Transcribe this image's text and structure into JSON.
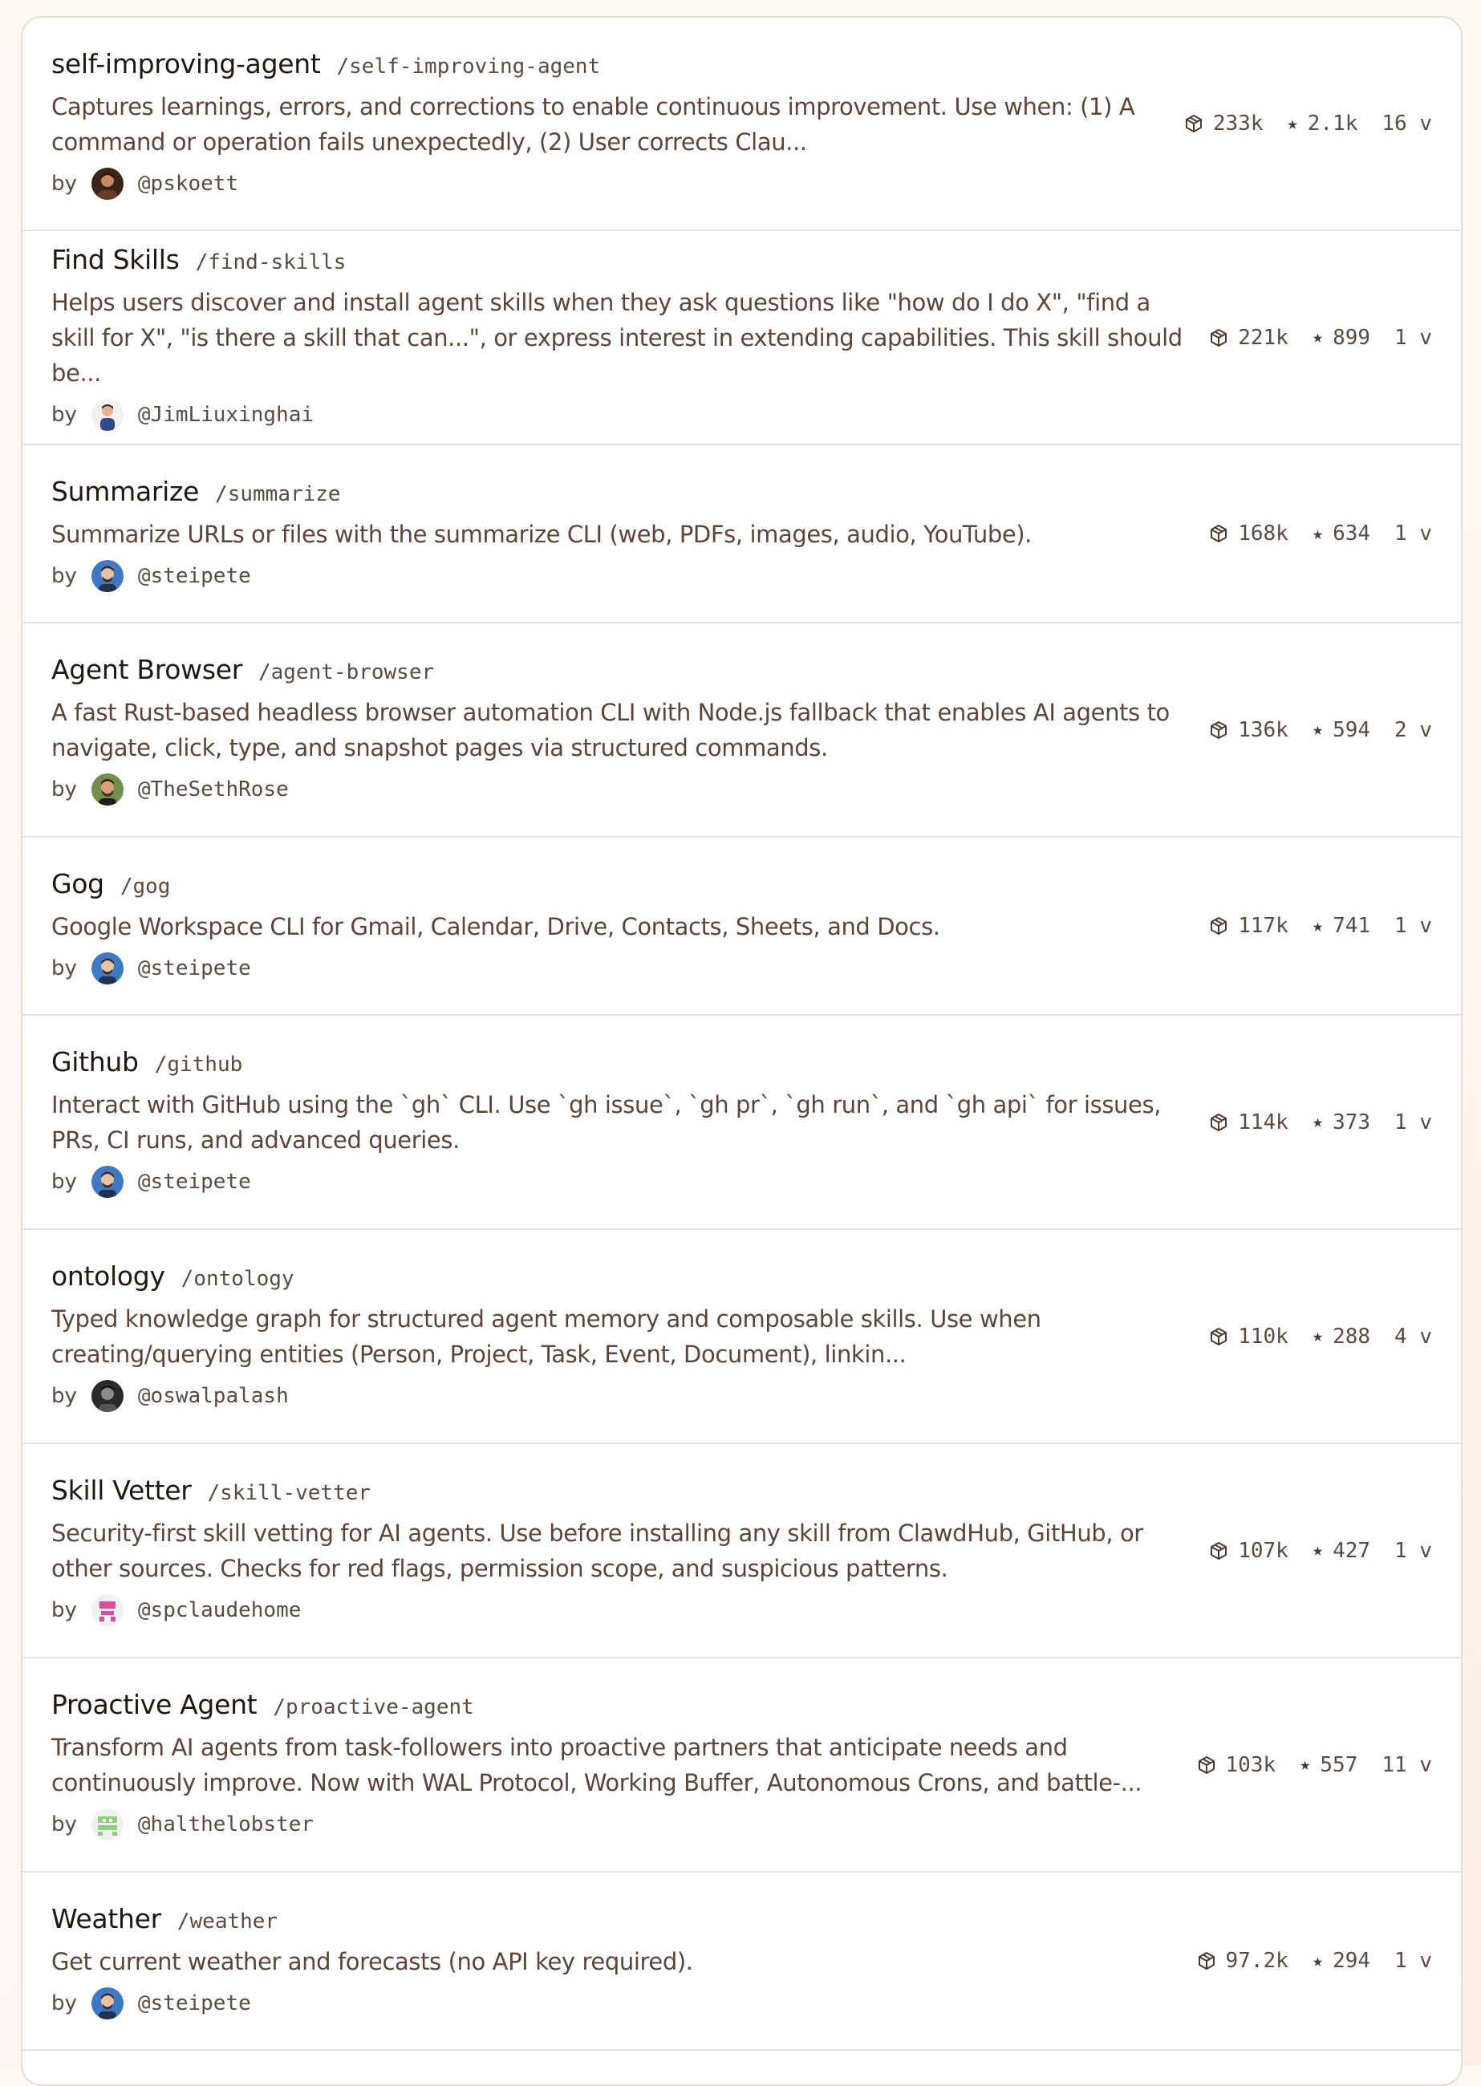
{
  "skills": [
    {
      "name": "self-improving-agent",
      "slug": "/self-improving-agent",
      "description": "Captures learnings, errors, and corrections to enable continuous improvement. Use when: (1) A command or operation fails unexpectedly, (2) User corrects Clau...",
      "by_label": "by",
      "author": "@pskoett",
      "avatar_icon": "user-avatar-icon",
      "downloads": "233k",
      "stars": "2.1k",
      "versions": "16 v"
    },
    {
      "name": "Find Skills",
      "slug": "/find-skills",
      "description": "Helps users discover and install agent skills when they ask questions like \"how do I do X\", \"find a skill for X\", \"is there a skill that can...\", or express interest in extending capabilities. This skill should be...",
      "by_label": "by",
      "author": "@JimLiuxinghai",
      "avatar_icon": "user-avatar-icon",
      "downloads": "221k",
      "stars": "899",
      "versions": "1 v"
    },
    {
      "name": "Summarize",
      "slug": "/summarize",
      "description": "Summarize URLs or files with the summarize CLI (web, PDFs, images, audio, YouTube).",
      "by_label": "by",
      "author": "@steipete",
      "avatar_icon": "user-avatar-icon",
      "downloads": "168k",
      "stars": "634",
      "versions": "1 v"
    },
    {
      "name": "Agent Browser",
      "slug": "/agent-browser",
      "description": "A fast Rust-based headless browser automation CLI with Node.js fallback that enables AI agents to navigate, click, type, and snapshot pages via structured commands.",
      "by_label": "by",
      "author": "@TheSethRose",
      "avatar_icon": "user-avatar-icon",
      "downloads": "136k",
      "stars": "594",
      "versions": "2 v"
    },
    {
      "name": "Gog",
      "slug": "/gog",
      "description": "Google Workspace CLI for Gmail, Calendar, Drive, Contacts, Sheets, and Docs.",
      "by_label": "by",
      "author": "@steipete",
      "avatar_icon": "user-avatar-icon",
      "downloads": "117k",
      "stars": "741",
      "versions": "1 v"
    },
    {
      "name": "Github",
      "slug": "/github",
      "description": "Interact with GitHub using the `gh` CLI. Use `gh issue`, `gh pr`, `gh run`, and `gh api` for issues, PRs, CI runs, and advanced queries.",
      "by_label": "by",
      "author": "@steipete",
      "avatar_icon": "user-avatar-icon",
      "downloads": "114k",
      "stars": "373",
      "versions": "1 v"
    },
    {
      "name": "ontology",
      "slug": "/ontology",
      "description": "Typed knowledge graph for structured agent memory and composable skills. Use when creating/querying entities (Person, Project, Task, Event, Document), linkin...",
      "by_label": "by",
      "author": "@oswalpalash",
      "avatar_icon": "user-avatar-icon",
      "downloads": "110k",
      "stars": "288",
      "versions": "4 v"
    },
    {
      "name": "Skill Vetter",
      "slug": "/skill-vetter",
      "description": "Security-first skill vetting for AI agents. Use before installing any skill from ClawdHub, GitHub, or other sources. Checks for red flags, permission scope, and suspicious patterns.",
      "by_label": "by",
      "author": "@spclaudehome",
      "avatar_icon": "identicon-avatar-icon",
      "downloads": "107k",
      "stars": "427",
      "versions": "1 v"
    },
    {
      "name": "Proactive Agent",
      "slug": "/proactive-agent",
      "description": "Transform AI agents from task-followers into proactive partners that anticipate needs and continuously improve. Now with WAL Protocol, Working Buffer, Autonomous Crons, and battle-...",
      "by_label": "by",
      "author": "@halthelobster",
      "avatar_icon": "identicon-avatar-icon",
      "downloads": "103k",
      "stars": "557",
      "versions": "11 v"
    },
    {
      "name": "Weather",
      "slug": "/weather",
      "description": "Get current weather and forecasts (no API key required).",
      "by_label": "by",
      "author": "@steipete",
      "avatar_icon": "user-avatar-icon",
      "downloads": "97.2k",
      "stars": "294",
      "versions": "1 v"
    }
  ],
  "icons": {
    "downloads": "package-icon",
    "stars": "star-icon"
  },
  "colors": {
    "text": "#1e1712",
    "muted": "#5a4b42",
    "description": "#5b4538",
    "divider": "#e8e0da",
    "background": "#fbf7f4"
  }
}
